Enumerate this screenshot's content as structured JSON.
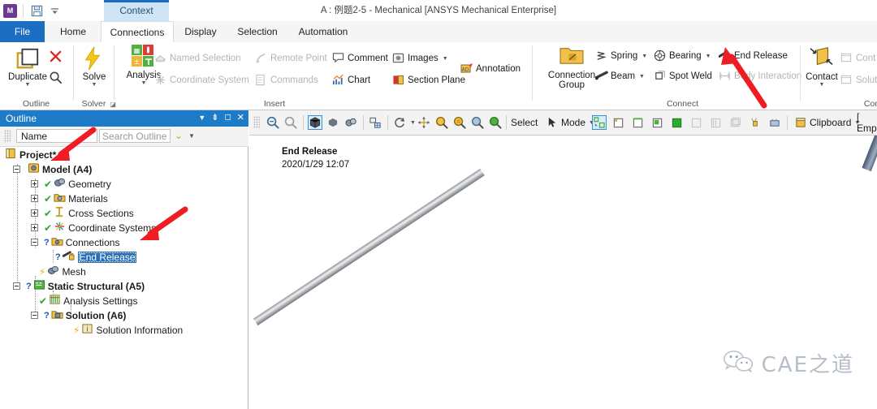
{
  "window": {
    "title": "A : 例题2-5 - Mechanical [ANSYS Mechanical Enterprise]",
    "quick_access": {
      "logo": "M",
      "save_icon": "save-icon",
      "dropdown_icon": "chevron-down-icon"
    }
  },
  "context_tab": {
    "label": "Context"
  },
  "ribbon": {
    "tabs": [
      {
        "label": "File",
        "state": "file"
      },
      {
        "label": "Home",
        "state": "normal"
      },
      {
        "label": "Connections",
        "state": "active"
      },
      {
        "label": "Display",
        "state": "normal"
      },
      {
        "label": "Selection",
        "state": "normal"
      },
      {
        "label": "Automation",
        "state": "normal"
      }
    ],
    "groups": [
      {
        "label": "Outline"
      },
      {
        "label": "Solver"
      },
      {
        "label": "Insert"
      },
      {
        "label": "Connect"
      },
      {
        "label": "Con"
      }
    ],
    "outline_group": {
      "duplicate": "Duplicate",
      "close_icon": "close-x-icon",
      "find_icon": "magnifier-icon"
    },
    "solver_group": {
      "solve": "Solve"
    },
    "insert_group": {
      "analysis": "Analysis",
      "named_selection": "Named Selection",
      "coordinate_system": "Coordinate System",
      "remote_point": "Remote Point",
      "commands": "Commands",
      "comment": "Comment",
      "chart": "Chart",
      "images": "Images",
      "section_plane": "Section Plane",
      "annotation": "Annotation"
    },
    "connect_group": {
      "connection_group_line1": "Connection",
      "connection_group_line2": "Group",
      "spring": "Spring",
      "beam": "Beam",
      "bearing": "Bearing",
      "spot_weld": "Spot Weld",
      "end_release": "End Release",
      "body_interaction": "Body Interaction"
    },
    "contact_group": {
      "contact": "Contact",
      "contact_tool": "Cont",
      "solution_info": "Solut"
    }
  },
  "outline_panel": {
    "title": "Outline",
    "header_icons": [
      "chevron-down-icon",
      "pin-icon",
      "maximize-icon",
      "close-icon"
    ],
    "name_column": "Name",
    "search_placeholder": "Search Outline",
    "filter_icon": "chevron-down-yellow-icon",
    "tree": [
      {
        "label": "Project*",
        "indent": 0,
        "bold": true,
        "expander": "none",
        "status": "none",
        "icon": "project-icon"
      },
      {
        "label": "Model (A4)",
        "indent": 1,
        "bold": true,
        "expander": "minus",
        "status": "none",
        "icon": "model-icon"
      },
      {
        "label": "Geometry",
        "indent": 2,
        "bold": false,
        "expander": "plus",
        "status": "check",
        "icon": "geometry-icon"
      },
      {
        "label": "Materials",
        "indent": 2,
        "bold": false,
        "expander": "plus",
        "status": "check",
        "icon": "materials-icon"
      },
      {
        "label": "Cross Sections",
        "indent": 2,
        "bold": false,
        "expander": "plus",
        "status": "check",
        "icon": "cross-sections-icon"
      },
      {
        "label": "Coordinate Systems",
        "indent": 2,
        "bold": false,
        "expander": "plus",
        "status": "check",
        "icon": "coordinate-systems-icon"
      },
      {
        "label": "Connections",
        "indent": 2,
        "bold": false,
        "expander": "minus",
        "status": "question",
        "icon": "connections-icon"
      },
      {
        "label": "End Release",
        "indent": 3,
        "bold": false,
        "expander": "none",
        "status": "question",
        "icon": "end-release-icon",
        "selected": true
      },
      {
        "label": "Mesh",
        "indent": 2,
        "bold": false,
        "expander": "none",
        "status": "bolt",
        "icon": "mesh-icon"
      },
      {
        "label": "Static Structural (A5)",
        "indent": 1,
        "bold": true,
        "expander": "minus",
        "status": "question",
        "icon": "static-structural-icon"
      },
      {
        "label": "Analysis Settings",
        "indent": 2,
        "bold": false,
        "expander": "none",
        "status": "check",
        "icon": "analysis-settings-icon"
      },
      {
        "label": "Solution (A6)",
        "indent": 2,
        "bold": true,
        "expander": "minus",
        "status": "question",
        "icon": "solution-icon"
      },
      {
        "label": "Solution Information",
        "indent": 3,
        "bold": false,
        "expander": "none",
        "status": "bolt",
        "icon": "solution-information-icon"
      }
    ]
  },
  "graphics_toolbar": {
    "icons": [
      "zoom-to-fit-icon",
      "magnifier-icon",
      "shaded-exterior-edges-icon",
      "shaded-exterior-icon",
      "wireframe-icon",
      "show-mesh-icon",
      "rotate-icon",
      "pan-icon",
      "zoom-icon",
      "box-zoom-icon",
      "zoom-fit-icon",
      "previous-view-icon"
    ],
    "select_label": "Select",
    "mode_label": "Mode",
    "selection_icons": [
      "select-mode-icon",
      "vertex-select-icon",
      "edge-select-icon",
      "face-select-icon",
      "body-select-icon",
      "extend-to-adjacent-icon",
      "extend-to-limits-icon",
      "extend-to-instances-icon",
      "single-select-icon",
      "box-select-icon"
    ],
    "clipboard_label": "Clipboard",
    "empty_label": "[ Emp"
  },
  "graphics_view": {
    "annotation_title": "End Release",
    "annotation_date": "2020/1/29 12:07",
    "watermark_text": "CAE之道",
    "watermark_icon": "wechat-icon",
    "beams": [
      {
        "name": "beam-left",
        "color": "#a8aaad",
        "highlight": "#e6e7e9"
      },
      {
        "name": "beam-right",
        "color": "#6b7c91",
        "highlight": "#93a1b3"
      }
    ]
  },
  "annotations": {
    "arrow_color": "#ee1c23",
    "arrows": [
      {
        "name": "arrow-to-end-release-ribbon"
      },
      {
        "name": "arrow-to-project"
      },
      {
        "name": "arrow-to-connections"
      }
    ]
  }
}
